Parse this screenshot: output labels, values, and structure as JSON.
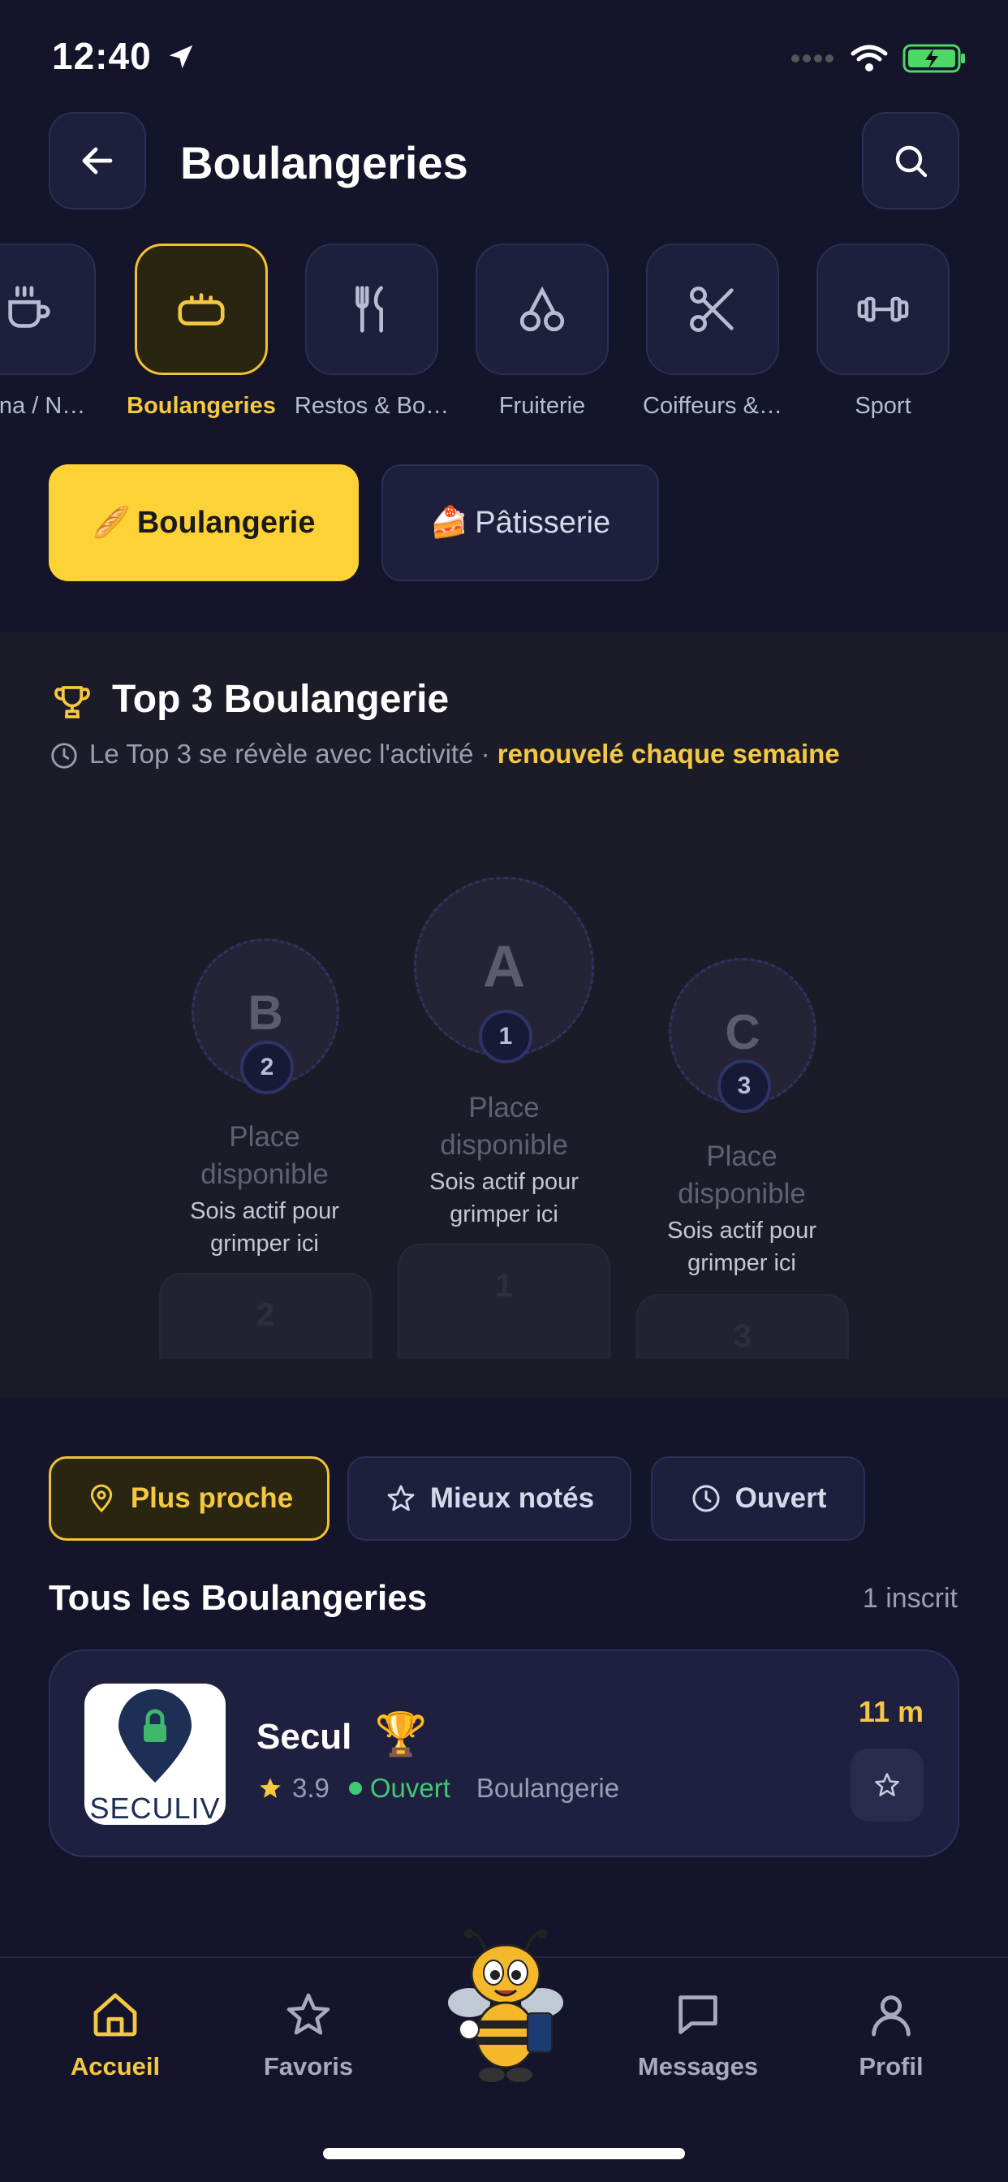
{
  "status_bar": {
    "time": "12:40"
  },
  "header": {
    "title": "Boulangeries"
  },
  "categories": [
    {
      "label": "gana / N…",
      "icon": "coffee-cup-icon",
      "active": false
    },
    {
      "label": "Boulangeries",
      "icon": "bread-loaf-icon",
      "active": true
    },
    {
      "label": "Restos & Bo…",
      "icon": "fork-knife-icon",
      "active": false
    },
    {
      "label": "Fruiterie",
      "icon": "cherries-icon",
      "active": false
    },
    {
      "label": "Coiffeurs &…",
      "icon": "scissors-icon",
      "active": false
    },
    {
      "label": "Sport",
      "icon": "dumbbell-icon",
      "active": false
    }
  ],
  "subcategories": [
    {
      "emoji": "🥖",
      "label": "Boulangerie",
      "active": true
    },
    {
      "emoji": "🍰",
      "label": "Pâtisserie",
      "active": false
    }
  ],
  "top3": {
    "title": "Top 3 Boulangerie",
    "subtitle": "Le Top 3 se révèle avec l'activité ·",
    "subtitle_highlight": "renouvelé chaque semaine",
    "podium": [
      {
        "letter": "B",
        "rank": "2",
        "place_line1": "Place",
        "place_line2": "disponible",
        "hint_line1": "Sois actif pour",
        "hint_line2": "grimper ici",
        "block_label": "2"
      },
      {
        "letter": "A",
        "rank": "1",
        "place_line1": "Place",
        "place_line2": "disponible",
        "hint_line1": "Sois actif pour",
        "hint_line2": "grimper ici",
        "block_label": "1"
      },
      {
        "letter": "C",
        "rank": "3",
        "place_line1": "Place",
        "place_line2": "disponible",
        "hint_line1": "Sois actif pour",
        "hint_line2": "grimper ici",
        "block_label": "3"
      }
    ]
  },
  "filters": [
    {
      "label": "Plus proche",
      "icon": "location-pin-icon",
      "active": true
    },
    {
      "label": "Mieux notés",
      "icon": "star-icon",
      "active": false
    },
    {
      "label": "Ouvert",
      "icon": "clock-icon",
      "active": false
    }
  ],
  "list": {
    "title": "Tous les Boulangeries",
    "count": "1 inscrit",
    "items": [
      {
        "name": "Secul",
        "badge": "🏆",
        "rating": "3.9",
        "status": "Ouvert",
        "category": "Boulangerie",
        "distance": "11 m",
        "logo_text": "SECULIV"
      }
    ]
  },
  "bottom_nav": [
    {
      "label": "Accueil",
      "icon": "home-icon",
      "active": true
    },
    {
      "label": "Favoris",
      "icon": "star-outline-icon",
      "active": false
    },
    {
      "label": "",
      "icon": "bee-mascot-icon",
      "active": false
    },
    {
      "label": "Messages",
      "icon": "chat-bubble-icon",
      "active": false
    },
    {
      "label": "Profil",
      "icon": "user-icon",
      "active": false
    }
  ],
  "colors": {
    "background": "#14142a",
    "accent": "#f5c842",
    "card": "#1f2040",
    "open": "#41c877"
  }
}
